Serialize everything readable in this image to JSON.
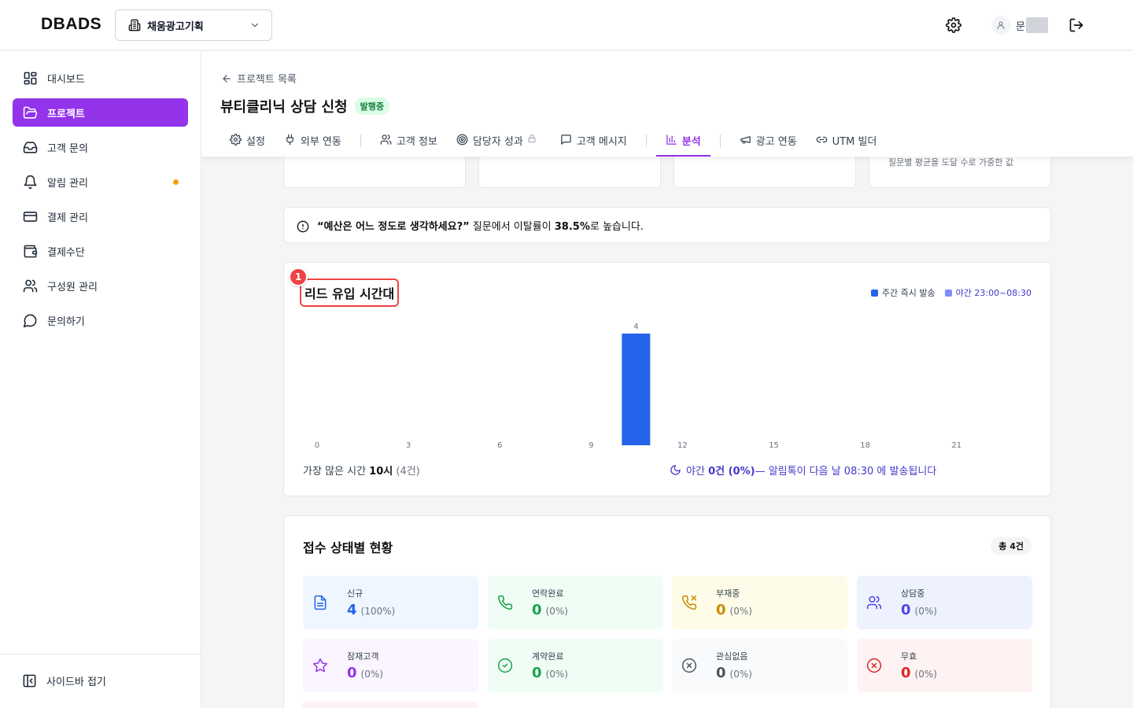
{
  "header": {
    "logo": "DBADS",
    "org_name": "채움광고기획",
    "user_initial": "문"
  },
  "sidebar": {
    "items": [
      {
        "label": "대시보드",
        "icon": "dashboard-icon"
      },
      {
        "label": "프로젝트",
        "icon": "folder-icon",
        "active": true
      },
      {
        "label": "고객 문의",
        "icon": "inbox-icon"
      },
      {
        "label": "알림 관리",
        "icon": "bell-icon",
        "dot": true
      },
      {
        "label": "결제 관리",
        "icon": "credit-card-icon"
      },
      {
        "label": "결제수단",
        "icon": "wallet-icon"
      },
      {
        "label": "구성원 관리",
        "icon": "users-icon"
      },
      {
        "label": "문의하기",
        "icon": "chat-icon"
      }
    ],
    "collapse_label": "사이드바 접기"
  },
  "page": {
    "back_label": "프로젝트 목록",
    "title": "뷰티클리닉 상담 신청",
    "status_badge": "발행중",
    "tabs": [
      {
        "label": "설정",
        "icon": "gear-icon"
      },
      {
        "label": "외부 연동",
        "icon": "plug-icon"
      },
      {
        "label": "고객 정보",
        "icon": "users-icon"
      },
      {
        "label": "담당자 성과",
        "icon": "target-icon",
        "locked": true
      },
      {
        "label": "고객 메시지",
        "icon": "message-icon"
      },
      {
        "label": "분석",
        "icon": "bar-chart-icon",
        "active": true
      },
      {
        "label": "광고 연동",
        "icon": "megaphone-icon"
      },
      {
        "label": "UTM 빌더",
        "icon": "link-icon"
      }
    ]
  },
  "top_cards": {
    "note": "질문별 평균을 도달 수로 가중한 값"
  },
  "alert": {
    "question": "“예산은 어느 정도로 생각하세요?”",
    "middle": " 질문에서 이탈률이 ",
    "rate": "38.5%",
    "end": "로 높습니다."
  },
  "lead_chart": {
    "marker": "1",
    "title": "리드 유입 시간대",
    "legend_day": "주간 즉시 발송",
    "legend_night": "야간 23:00~08:30",
    "peak_prefix": "가장 많은 시간 ",
    "peak_hour": "10시",
    "peak_count": "(4건)",
    "night_prefix": "야간 ",
    "night_value": "0건 (0%)",
    "night_suffix": " — 알림톡이 다음 날 08:30 에 발송됩니다",
    "colors": {
      "day": "#2563eb",
      "night": "#818cf8"
    }
  },
  "chart_data": {
    "type": "bar",
    "title": "리드 유입 시간대",
    "x": [
      0,
      1,
      2,
      3,
      4,
      5,
      6,
      7,
      8,
      9,
      10,
      11,
      12,
      13,
      14,
      15,
      16,
      17,
      18,
      19,
      20,
      21,
      22,
      23
    ],
    "tick_labels": [
      "0",
      "3",
      "6",
      "9",
      "12",
      "15",
      "18",
      "21"
    ],
    "series": [
      {
        "name": "주간 즉시 발송",
        "values": [
          0,
          0,
          0,
          0,
          0,
          0,
          0,
          0,
          0,
          0,
          4,
          0,
          0,
          0,
          0,
          0,
          0,
          0,
          0,
          0,
          0,
          0,
          0,
          0
        ]
      },
      {
        "name": "야간 23:00~08:30",
        "values": [
          0,
          0,
          0,
          0,
          0,
          0,
          0,
          0,
          0,
          0,
          0,
          0,
          0,
          0,
          0,
          0,
          0,
          0,
          0,
          0,
          0,
          0,
          0,
          0
        ]
      }
    ],
    "data_labels": [
      {
        "x": 10,
        "label": "4"
      }
    ],
    "ylim": [
      0,
      4
    ],
    "grid": false,
    "legend": "top-right"
  },
  "status": {
    "title": "접수 상태별 현황",
    "total": "총 4건",
    "tiles": [
      {
        "label": "신규",
        "value": "4",
        "pct": "(100%)",
        "bg": "#eff6ff",
        "color": "#2563eb",
        "icon": "document-icon"
      },
      {
        "label": "연락완료",
        "value": "0",
        "pct": "(0%)",
        "bg": "#f0fdf4",
        "color": "#16a34a",
        "icon": "phone-icon"
      },
      {
        "label": "부재중",
        "value": "0",
        "pct": "(0%)",
        "bg": "#fefce8",
        "color": "#ca8a04",
        "icon": "phone-missed-icon"
      },
      {
        "label": "상담중",
        "value": "0",
        "pct": "(0%)",
        "bg": "#eef2ff",
        "color": "#4f46e5",
        "icon": "users-icon"
      },
      {
        "label": "잠재고객",
        "value": "0",
        "pct": "(0%)",
        "bg": "#faf5ff",
        "color": "#9333ea",
        "icon": "star-icon"
      },
      {
        "label": "계약완료",
        "value": "0",
        "pct": "(0%)",
        "bg": "#f0fdf4",
        "color": "#16a34a",
        "icon": "check-circle-icon"
      },
      {
        "label": "관심없음",
        "value": "0",
        "pct": "(0%)",
        "bg": "#f9fafb",
        "color": "#4b5563",
        "icon": "x-circle-icon"
      },
      {
        "label": "무효",
        "value": "0",
        "pct": "(0%)",
        "bg": "#fef2f2",
        "color": "#dc2626",
        "icon": "x-circle-icon"
      }
    ]
  }
}
